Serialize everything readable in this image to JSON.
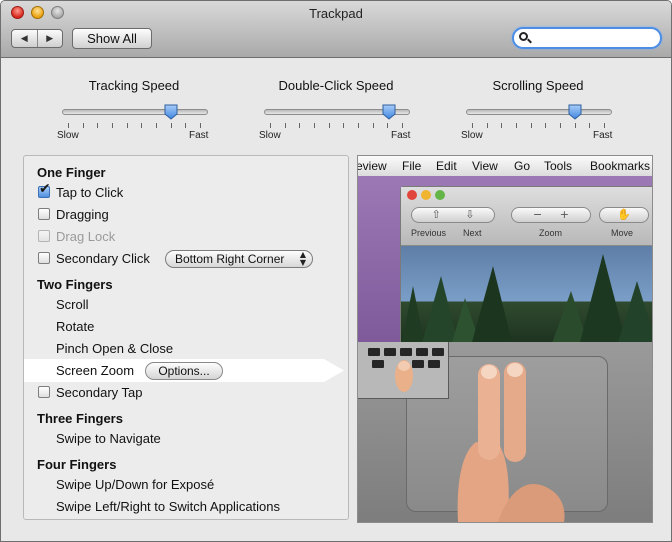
{
  "window": {
    "title": "Trackpad",
    "back_glyph": "◀",
    "forward_glyph": "▶",
    "show_all_label": "Show All",
    "search_value": ""
  },
  "sliders": [
    {
      "label": "Tracking Speed",
      "min_label": "Slow",
      "max_label": "Fast",
      "value_fraction": 0.76
    },
    {
      "label": "Double-Click Speed",
      "min_label": "Slow",
      "max_label": "Fast",
      "value_fraction": 0.87
    },
    {
      "label": "Scrolling Speed",
      "min_label": "Slow",
      "max_label": "Fast",
      "value_fraction": 0.76
    }
  ],
  "gestures": {
    "one_finger": {
      "header": "One Finger",
      "tap_to_click": {
        "label": "Tap to Click",
        "checked": true
      },
      "dragging": {
        "label": "Dragging",
        "checked": false
      },
      "drag_lock": {
        "label": "Drag Lock",
        "checked": false,
        "enabled": false
      },
      "secondary_click": {
        "label": "Secondary Click",
        "checked": false,
        "popup_value": "Bottom Right Corner"
      }
    },
    "two_fingers": {
      "header": "Two Fingers",
      "scroll": "Scroll",
      "rotate": "Rotate",
      "pinch": "Pinch Open & Close",
      "screen_zoom": "Screen Zoom",
      "options_label": "Options...",
      "secondary_tap": {
        "label": "Secondary Tap",
        "checked": false
      }
    },
    "three_fingers": {
      "header": "Three Fingers",
      "swipe": "Swipe to Navigate"
    },
    "four_fingers": {
      "header": "Four Fingers",
      "expose": "Swipe Up/Down for Exposé",
      "switch_apps": "Swipe Left/Right to Switch Applications"
    }
  },
  "preview": {
    "menu": [
      "eview",
      "File",
      "Edit",
      "View",
      "Go",
      "Tools",
      "Bookmarks"
    ],
    "toolbar": {
      "previous": "Previous",
      "next": "Next",
      "zoom": "Zoom",
      "move": "Move"
    }
  },
  "colors": {
    "search_focus": "#4c8de6",
    "checkbox_checked": "#5090e0",
    "slider_thumb": "#3f86e0"
  }
}
